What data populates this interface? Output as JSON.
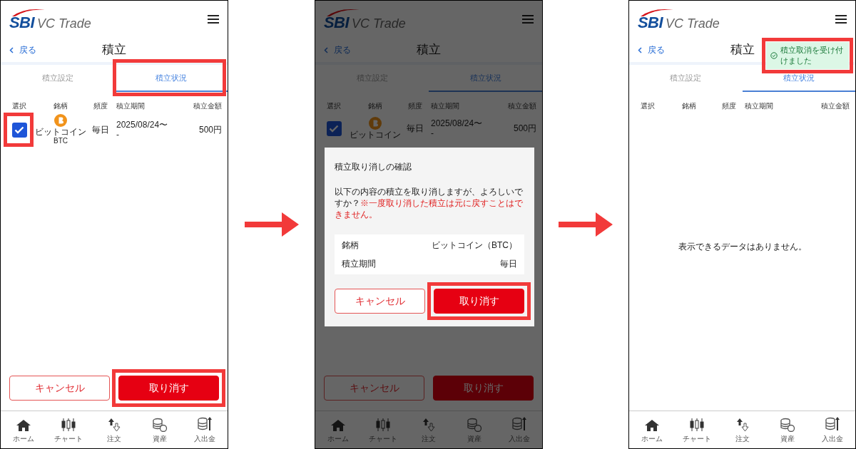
{
  "screens": [
    {
      "logo": {
        "brand": "SBI",
        "product": "VC Trade"
      },
      "back": "戻る",
      "title": "積立",
      "tabs": [
        {
          "label": "積立設定",
          "selected": false,
          "highlighted": false
        },
        {
          "label": "積立状況",
          "selected": true,
          "highlighted": true
        }
      ],
      "columns": [
        "選択",
        "銘柄",
        "頻度",
        "積立期間",
        "積立金額"
      ],
      "rows": [
        {
          "checked": true,
          "highlighted": true,
          "coin": "ビットコイン",
          "symbol": "BTC",
          "frequency": "毎日",
          "period_start": "2025/08/24〜",
          "period_end": "-",
          "amount": "500円"
        }
      ],
      "actions": [
        {
          "label": "キャンセル",
          "kind": "outline",
          "highlighted": false
        },
        {
          "label": "取り消す",
          "kind": "primary",
          "highlighted": true
        }
      ],
      "nav": [
        {
          "label": "ホーム",
          "kind": "home"
        },
        {
          "label": "チャート",
          "kind": "chart"
        },
        {
          "label": "注文",
          "kind": "order"
        },
        {
          "label": "資産",
          "kind": "assets"
        },
        {
          "label": "入出金",
          "kind": "transfer"
        }
      ]
    },
    {
      "logo": {
        "brand": "SBI",
        "product": "VC Trade"
      },
      "back": "戻る",
      "title": "積立",
      "tabs": [
        {
          "label": "積立設定",
          "selected": false,
          "highlighted": false
        },
        {
          "label": "積立状況",
          "selected": true,
          "highlighted": false
        }
      ],
      "columns": [
        "選択",
        "銘柄",
        "頻度",
        "積立期間",
        "積立金額"
      ],
      "rows": [
        {
          "checked": true,
          "highlighted": false,
          "coin": "ビットコイン",
          "frequency": "毎日",
          "period_start": "2025/08/24〜",
          "period_end": "-",
          "amount": "500円"
        }
      ],
      "actions": [
        {
          "label": "キャンセル",
          "kind": "outline",
          "highlighted": false
        },
        {
          "label": "取り消す",
          "kind": "primary",
          "highlighted": false
        }
      ],
      "nav": [
        {
          "label": "ホーム",
          "kind": "home"
        },
        {
          "label": "チャート",
          "kind": "chart"
        },
        {
          "label": "注文",
          "kind": "order"
        },
        {
          "label": "資産",
          "kind": "assets"
        },
        {
          "label": "入出金",
          "kind": "transfer"
        }
      ],
      "dialog": {
        "title": "積立取り消しの確認",
        "message": "以下の内容の積立を取り消しますが、よろしいですか？",
        "warning": "※一度取り消した積立は元に戻すことはできません。",
        "details": [
          {
            "label": "銘柄",
            "value": "ビットコイン（BTC）"
          },
          {
            "label": "積立期間",
            "value": "毎日"
          }
        ],
        "buttons": [
          {
            "label": "キャンセル",
            "kind": "outline",
            "highlighted": false
          },
          {
            "label": "取り消す",
            "kind": "primary",
            "highlighted": true
          }
        ]
      }
    },
    {
      "logo": {
        "brand": "SBI",
        "product": "VC Trade"
      },
      "back": "戻る",
      "title": "積立",
      "tabs": [
        {
          "label": "積立設定",
          "selected": false,
          "highlighted": false
        },
        {
          "label": "積立状況",
          "selected": true,
          "highlighted": false
        }
      ],
      "columns": [
        "選択",
        "銘柄",
        "頻度",
        "積立期間",
        "積立金額"
      ],
      "empty_message": "表示できるデータはありません。",
      "nav": [
        {
          "label": "ホーム",
          "kind": "home"
        },
        {
          "label": "チャート",
          "kind": "chart"
        },
        {
          "label": "注文",
          "kind": "order"
        },
        {
          "label": "資産",
          "kind": "assets"
        },
        {
          "label": "入出金",
          "kind": "transfer"
        }
      ],
      "toast": {
        "text": "積立取消を受け付けました",
        "highlighted": true
      }
    }
  ]
}
